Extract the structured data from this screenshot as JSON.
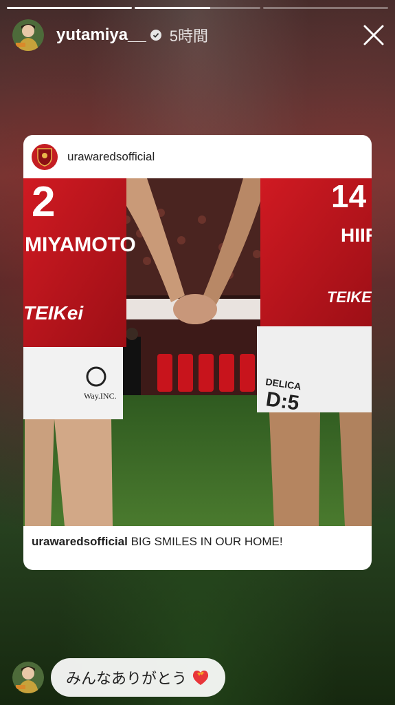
{
  "progress": [
    1.0,
    0.6,
    0.0
  ],
  "header": {
    "username": "yutamiya__",
    "time": "5時間"
  },
  "card": {
    "account": "urawaredsofficial",
    "caption_user": "urawaredsofficial",
    "caption_text": "BIG SMILES IN OUR HOME!",
    "photo_texts": {
      "left_name": "MIYAMOTO",
      "right_name": "HIIRO",
      "left_sponsor": "TEIKei",
      "right_sponsor": "TEIKE",
      "shorts_left": "Way.INC.",
      "shorts_right_1": "DELICA",
      "shorts_right_2": "D:5",
      "left_number": "2",
      "right_number": "14"
    }
  },
  "reply": {
    "text": "みんなありがとう"
  },
  "colors": {
    "kit_red": "#c1161f",
    "grass": "#3a6b25"
  }
}
